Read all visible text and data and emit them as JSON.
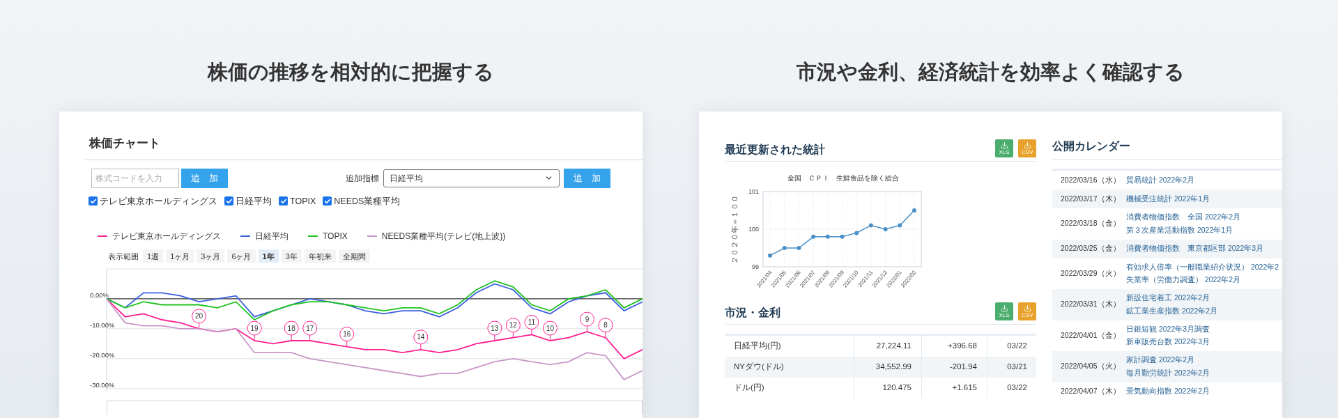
{
  "stock_panel": {
    "heading": "株価の推移を相対的に把握する",
    "title": "株価チャート",
    "code_input": {
      "placeholder": "株式コードを入力"
    },
    "add_button": "追　加",
    "indicator_label": "追加指標",
    "indicator_select": "日経平均",
    "indicator_add_button": "追　加",
    "checkboxes": [
      {
        "label": "テレビ東京ホールディングス",
        "checked": true
      },
      {
        "label": "日経平均",
        "checked": true
      },
      {
        "label": "TOPIX",
        "checked": true
      },
      {
        "label": "NEEDS業種平均",
        "checked": true
      }
    ],
    "range_label": "表示範囲",
    "ranges": [
      {
        "label": "1週",
        "selected": false
      },
      {
        "label": "1ヶ月",
        "selected": false
      },
      {
        "label": "3ヶ月",
        "selected": false
      },
      {
        "label": "6ヶ月",
        "selected": false
      },
      {
        "label": "1年",
        "selected": true
      },
      {
        "label": "3年",
        "selected": false
      },
      {
        "label": "年初来",
        "selected": false
      },
      {
        "label": "全期間",
        "selected": false
      }
    ],
    "chart_data": {
      "type": "line",
      "grid": true,
      "ylim": [
        -31,
        10
      ],
      "yticks": [
        {
          "value": 0,
          "label": "0.00%"
        },
        {
          "value": -10,
          "label": "-10.00%"
        },
        {
          "value": -20,
          "label": "-20.00%"
        },
        {
          "value": -30,
          "label": "-30.00%"
        }
      ],
      "series": [
        {
          "name": "テレビ東京ホールディングス",
          "color": "#ff1f8e",
          "values": [
            0,
            -6,
            -5,
            -7,
            -8,
            -10,
            -11,
            -10,
            -14,
            -15,
            -14,
            -14,
            -15,
            -16,
            -17,
            -17,
            -18,
            -17,
            -18,
            -17,
            -15,
            -14,
            -13,
            -12,
            -14,
            -13,
            -11,
            -13,
            -20,
            -17
          ]
        },
        {
          "name": "日経平均",
          "color": "#3a5fe0",
          "values": [
            0,
            -3,
            2,
            2,
            1,
            -1,
            0,
            1,
            -6,
            -4,
            -2,
            0,
            -1,
            -2,
            -4,
            -5,
            -4,
            -4,
            -6,
            -3,
            2,
            5,
            3,
            -3,
            -5,
            -1,
            1,
            2,
            -4,
            -1
          ]
        },
        {
          "name": "TOPIX",
          "color": "#1ec31e",
          "values": [
            0,
            -3,
            -1,
            -2,
            -2,
            -2,
            -3,
            -1,
            -7,
            -4,
            -2,
            -1,
            -1,
            -2,
            -3,
            -4,
            -3,
            -3,
            -5,
            -2,
            3,
            6,
            4,
            -2,
            -4,
            0,
            1,
            3,
            -3,
            0
          ]
        },
        {
          "name": "NEEDS業種平均(テレビ(地上波))",
          "color": "#c896c8",
          "values": [
            0,
            -8,
            -9,
            -9,
            -10,
            -10,
            -11,
            -10,
            -18,
            -18,
            -18,
            -20,
            -21,
            -22,
            -23,
            -24,
            -25,
            -26,
            -25,
            -25,
            -23,
            -21,
            -20,
            -21,
            -22,
            -21,
            -18,
            -19,
            -27,
            -24
          ]
        }
      ],
      "annotations": [
        {
          "text": "20"
        },
        {
          "text": "19"
        },
        {
          "text": "18"
        },
        {
          "text": "17"
        },
        {
          "text": "16"
        },
        {
          "text": "14"
        },
        {
          "text": "13"
        },
        {
          "text": "12"
        },
        {
          "text": "11"
        },
        {
          "text": "10"
        },
        {
          "text": "9"
        },
        {
          "text": "8"
        }
      ]
    }
  },
  "market_panel": {
    "heading": "市況や金利、経済統計を効率よく確認する",
    "stats": {
      "title": "最近更新された統計",
      "buttons": [
        {
          "label": "XLS",
          "kind": "xls"
        },
        {
          "label": "CSV",
          "kind": "csv"
        }
      ],
      "chart_data": {
        "type": "line",
        "grid": true,
        "title": "全国　ＣＰＩ　生鮮食品を除く総合",
        "ylabel": "２０２０年＝１００",
        "categories": [
          "2021/04",
          "2021/05",
          "2021/06",
          "2021/07",
          "2021/08",
          "2021/09",
          "2021/10",
          "2021/11",
          "2021/12",
          "2022/01",
          "2022/02"
        ],
        "series": [
          {
            "color": "#4a90c8",
            "marker": "circle",
            "values": [
              99.3,
              99.5,
              99.5,
              99.8,
              99.8,
              99.8,
              99.9,
              100.1,
              100.0,
              100.1,
              100.5
            ]
          }
        ],
        "ylim": [
          99,
          101
        ],
        "yticks": [
          99,
          100,
          101
        ],
        "ref_lines": [
          {
            "value": 100,
            "axis": "y"
          }
        ]
      }
    },
    "market": {
      "title": "市況・金利",
      "buttons": [
        {
          "label": "XLS",
          "kind": "xls"
        },
        {
          "label": "CSV",
          "kind": "csv"
        }
      ],
      "rows": [
        {
          "name": "日経平均(円)",
          "value": "27,224.11",
          "change": "+396.68",
          "date": "03/22"
        },
        {
          "name": "NYダウ(ドル)",
          "value": "34,552.99",
          "change": "-201.94",
          "date": "03/21"
        },
        {
          "name": "ドル(円)",
          "value": "120.475",
          "change": "+1.615",
          "date": "03/22"
        }
      ]
    },
    "calendar": {
      "title": "公開カレンダー",
      "rows": [
        {
          "date": "2022/03/16（水）",
          "items": [
            "貿易統計 2022年2月"
          ]
        },
        {
          "date": "2022/03/17（木）",
          "items": [
            "機械受注統計 2022年1月"
          ]
        },
        {
          "date": "2022/03/18（金）",
          "items": [
            "消費者物価指数　全国 2022年2月",
            "第３次産業活動指数 2022年1月"
          ]
        },
        {
          "date": "2022/03/25（金）",
          "items": [
            "消費者物価指数　東京都区部 2022年3月"
          ]
        },
        {
          "date": "2022/03/29（火）",
          "items": [
            "有効求人倍率（一般職業紹介状況） 2022年2",
            "失業率（労働力調査） 2022年2月"
          ]
        },
        {
          "date": "2022/03/31（木）",
          "items": [
            "新設住宅着工 2022年2月",
            "鉱工業生産指数 2022年2月"
          ]
        },
        {
          "date": "2022/04/01（金）",
          "items": [
            "日銀短観 2022年3月調査",
            "新車販売台数 2022年3月"
          ]
        },
        {
          "date": "2022/04/05（火）",
          "items": [
            "家計調査 2022年2月",
            "毎月勤労統計 2022年2月"
          ]
        },
        {
          "date": "2022/04/07（木）",
          "items": [
            "景気動向指数 2022年2月"
          ]
        }
      ]
    }
  }
}
